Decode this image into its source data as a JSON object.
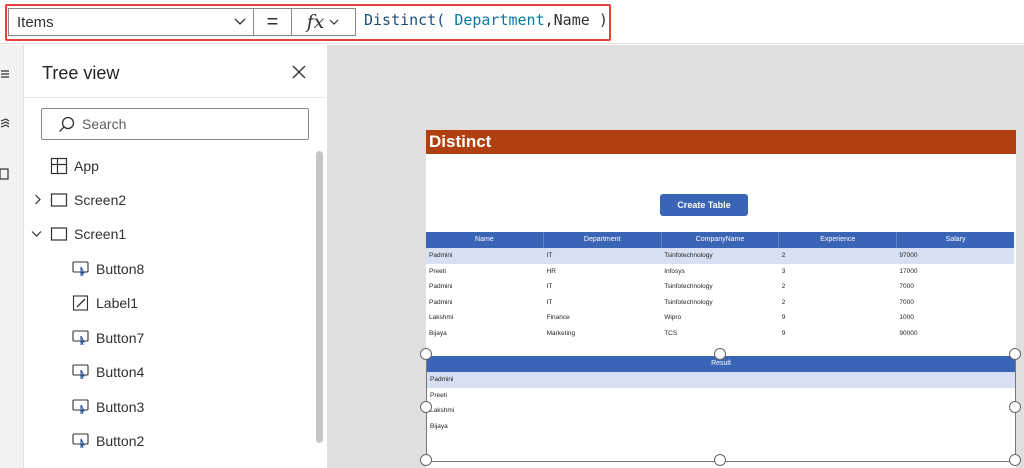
{
  "formula_bar": {
    "property": "Items",
    "equals": "=",
    "fx_label": "fx",
    "formula_fn": "Distinct(",
    "formula_arg1": "Department",
    "formula_comma": ",",
    "formula_arg2": "Name",
    "formula_close": ")"
  },
  "tree_view": {
    "title": "Tree view",
    "search_placeholder": "Search",
    "items": [
      {
        "label": "App",
        "icon": "app-icon"
      },
      {
        "label": "Screen2",
        "icon": "screen-icon",
        "expanded": false
      },
      {
        "label": "Screen1",
        "icon": "screen-icon",
        "expanded": true
      },
      {
        "label": "Button8",
        "icon": "button-icon"
      },
      {
        "label": "Label1",
        "icon": "label-icon"
      },
      {
        "label": "Button7",
        "icon": "button-icon"
      },
      {
        "label": "Button4",
        "icon": "button-icon"
      },
      {
        "label": "Button3",
        "icon": "button-icon"
      },
      {
        "label": "Button2",
        "icon": "button-icon"
      }
    ]
  },
  "screen": {
    "header": "Distinct",
    "create_button": "Create Table",
    "table": {
      "columns": [
        "Name",
        "Department",
        "CompanyName",
        "Experience",
        "Salary"
      ],
      "rows": [
        [
          "Padmini",
          "IT",
          "Tsinfotechnology",
          "2",
          "97000"
        ],
        [
          "Preeti",
          "HR",
          "Infosys",
          "3",
          "17000"
        ],
        [
          "Padmini",
          "IT",
          "Tsinfotechnology",
          "2",
          "7000"
        ],
        [
          "Padmini",
          "IT",
          "Tsinfotechnology",
          "2",
          "7000"
        ],
        [
          "Lakshmi",
          "Finance",
          "Wipro",
          "9",
          "1000"
        ],
        [
          "Bijaya",
          "Marketing",
          "TCS",
          "9",
          "90000"
        ]
      ]
    },
    "result": {
      "header": "Result",
      "rows": [
        "Padmini",
        "Preeti",
        "Lakshmi",
        "Bijaya"
      ]
    }
  },
  "colors": {
    "header_bg": "#b04010",
    "table_header": "#3a64b6",
    "selected_row": "#d6e0f2",
    "highlight_border": "#e8413b"
  }
}
